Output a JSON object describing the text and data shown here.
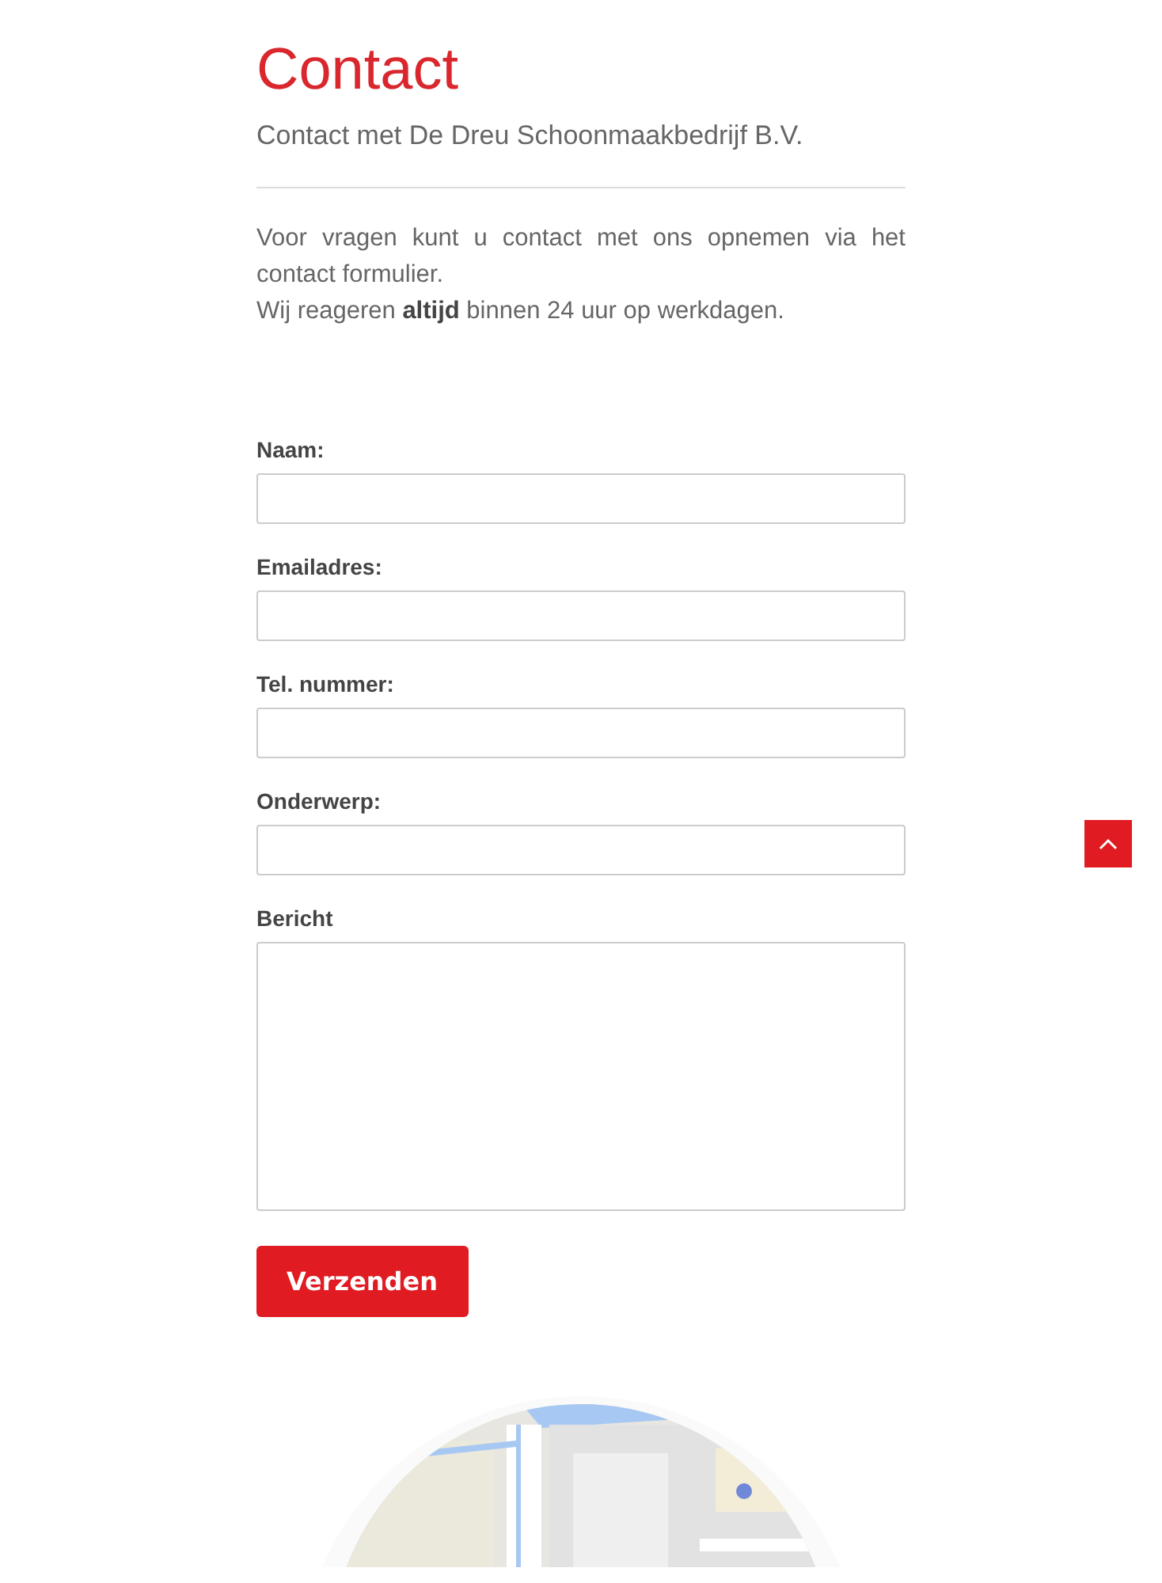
{
  "title": "Contact",
  "subtitle": "Contact met De Dreu Schoonmaakbedrijf B.V.",
  "intro": [
    "Voor vragen kunt u contact met ons opnemen via het contact formulier.",
    "Wij reageren **altijd** binnen 24 uur op werkdagen."
  ],
  "form": {
    "fields": [
      {
        "label": "Naam:",
        "kind": "input"
      },
      {
        "label": "Emailadres:",
        "kind": "input"
      },
      {
        "label": "Tel. nummer:",
        "kind": "input"
      },
      {
        "label": "Onderwerp:",
        "kind": "input"
      },
      {
        "label": "Bericht",
        "kind": "textarea"
      }
    ],
    "submit": "Verzenden"
  },
  "scroll_top": {
    "kind": "button"
  }
}
